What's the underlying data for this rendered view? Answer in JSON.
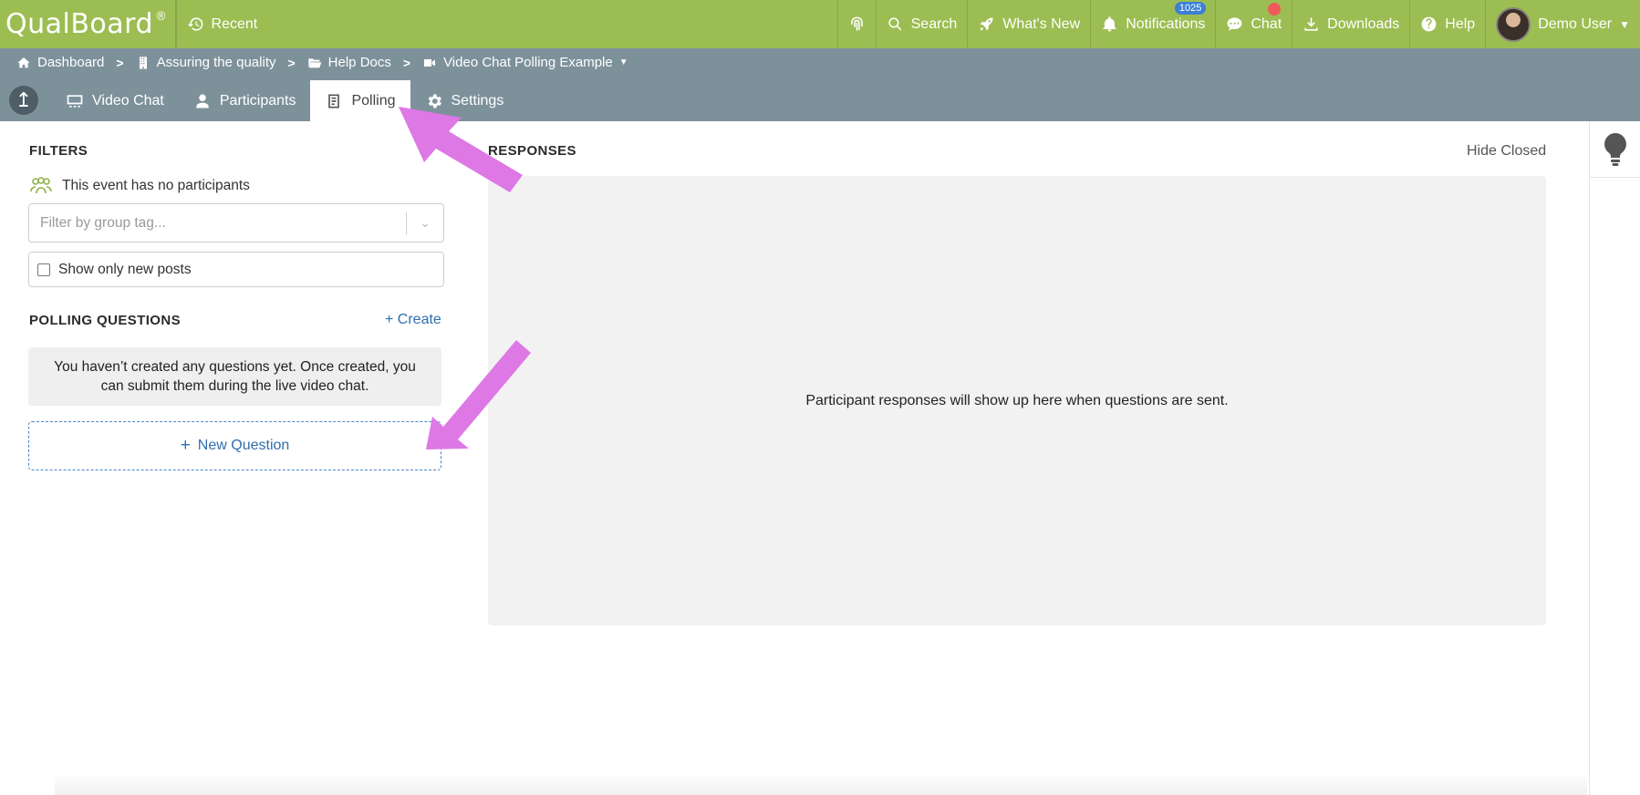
{
  "topbar": {
    "logo": "QualBoard",
    "logo_mark": "®",
    "recent": "Recent",
    "items": {
      "search": "Search",
      "whats_new": "What's New",
      "notifications": "Notifications",
      "notifications_count": "1025",
      "chat": "Chat",
      "downloads": "Downloads",
      "help": "Help",
      "user": "Demo User"
    },
    "colors": {
      "bar": "#9cbd52",
      "badge": "#3b7fd6",
      "dot": "#ef5b5b"
    }
  },
  "breadcrumb": {
    "items": [
      "Dashboard",
      "Assuring the quality",
      "Help Docs",
      "Video Chat Polling Example"
    ]
  },
  "tabs": {
    "items": [
      "Video Chat",
      "Participants",
      "Polling",
      "Settings"
    ],
    "active": "Polling"
  },
  "filters": {
    "heading": "FILTERS",
    "no_participants": "This event has no participants",
    "group_tag_placeholder": "Filter by group tag...",
    "show_new_label": "Show only new posts"
  },
  "polling": {
    "heading": "POLLING QUESTIONS",
    "create_label": "+ Create",
    "empty_text": "You haven’t created any questions yet. Once created, you can submit them during the live video chat.",
    "new_question_label": "New Question"
  },
  "responses": {
    "heading": "RESPONSES",
    "hide_closed": "Hide Closed",
    "empty_text": "Participant responses will show up here when questions are sent."
  },
  "annotation_color": "#dd78e4"
}
